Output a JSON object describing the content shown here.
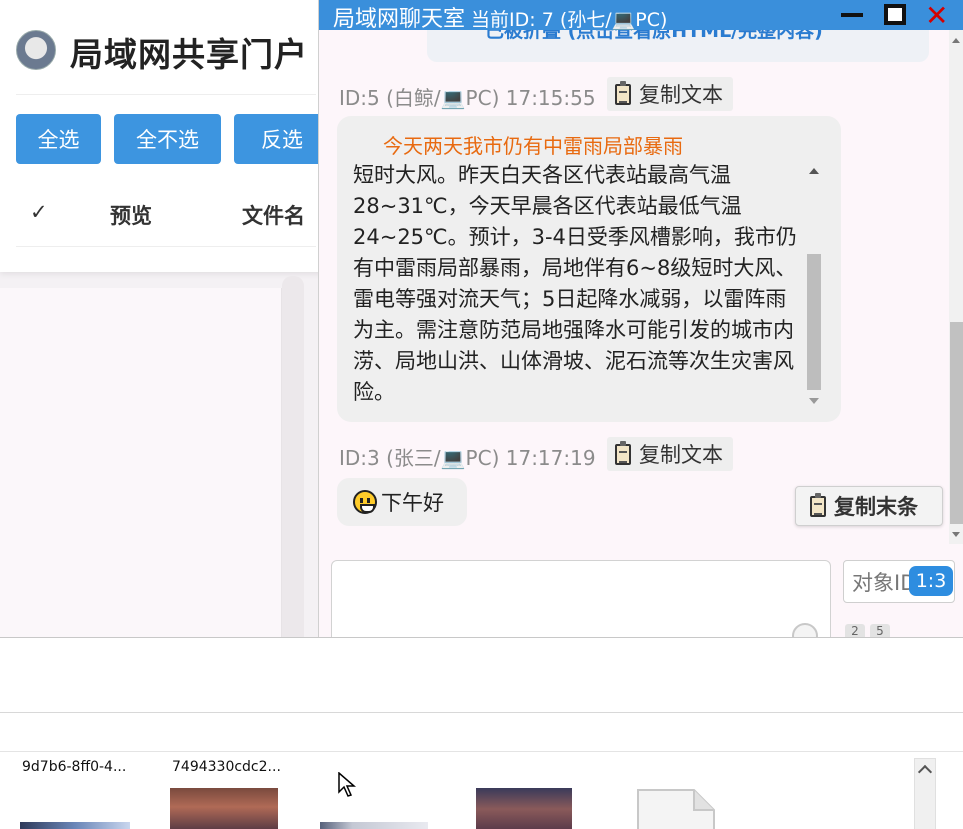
{
  "portal": {
    "title": "局域网共享门户",
    "buttons": {
      "select_all": "全选",
      "select_none": "全不选",
      "invert": "反选"
    },
    "table_headers": {
      "check": "✓",
      "preview": "预览",
      "filename": "文件名"
    }
  },
  "chat": {
    "title": "局域网聊天室",
    "current_id": "当前ID: 7 (孙七/💻PC)",
    "partial_top_text": "已被折叠 (点击查看原HTML/完整内容)",
    "messages": [
      {
        "meta": "ID:5 (白鲸/💻PC) 17:15:55",
        "copy_label": "复制文本",
        "headline": "今天两天我市仍有中雷雨局部暴雨",
        "body": "短时大风。昨天白天各区代表站最高气温28~31℃，今天早晨各区代表站最低气温24~25℃。预计，3-4日受季风槽影响，我市仍有中雷雨局部暴雨，局地伴有6~8级短时大风、雷电等强对流天气；5日起降水减弱，以雷阵雨为主。需注意防范局地强降水可能引发的城市内涝、局地山洪、山体滑坡、泥石流等次生灾害风险。"
      },
      {
        "meta": "ID:3 (张三/💻PC) 17:17:19",
        "copy_label": "复制文本",
        "body": "下午好"
      }
    ],
    "copy_last_label": "复制末条",
    "target_placeholder": "对象ID",
    "ratio_badge": "1:3",
    "tiny_pills": [
      "2",
      "5"
    ]
  },
  "explorer": {
    "files": [
      {
        "name": "9d7b6-8ff0-4..."
      },
      {
        "name": "7494330cdc2..."
      }
    ]
  },
  "colors": {
    "accent": "#3a8fdb",
    "button": "#3d95e0",
    "headline": "#e86a10",
    "close": "#d40000"
  }
}
